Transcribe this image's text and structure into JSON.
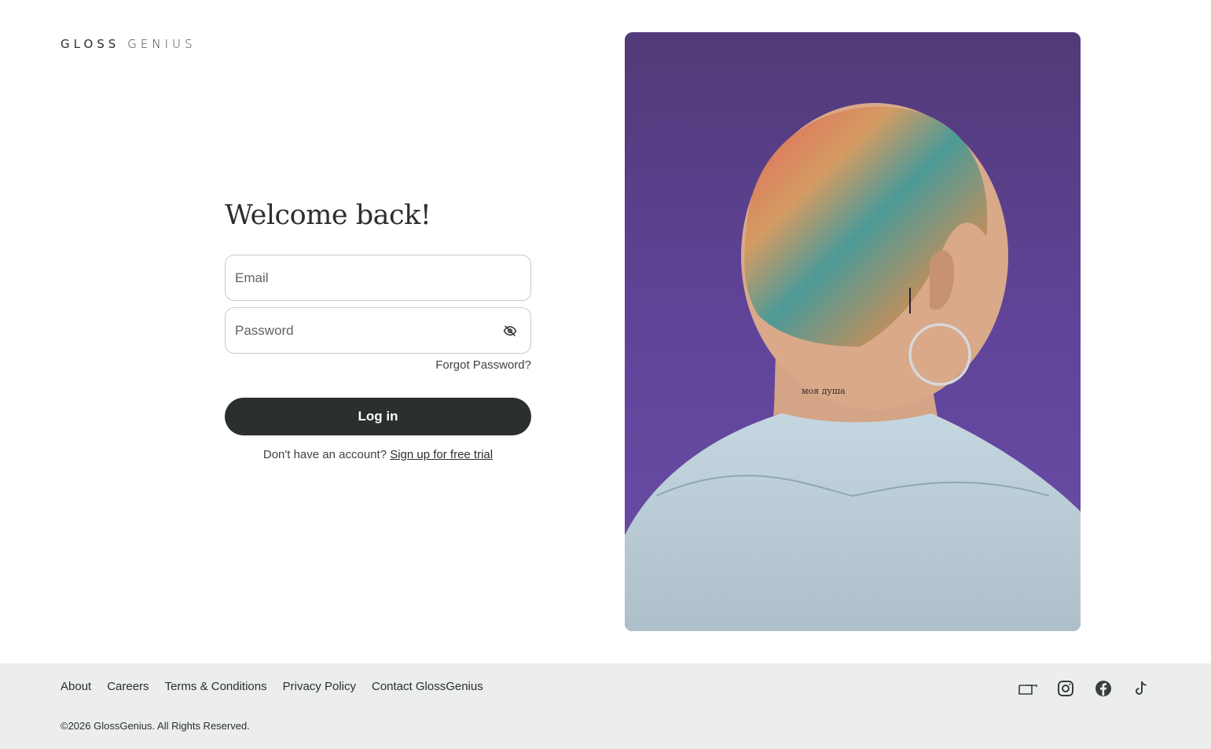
{
  "brand": {
    "word1": "GLOSS",
    "word2": "GENIUS"
  },
  "login": {
    "title": "Welcome back!",
    "email_placeholder": "Email",
    "password_placeholder": "Password",
    "forgot_label": "Forgot Password?",
    "login_label": "Log in",
    "signup_prompt": "Don't have an account?",
    "signup_link": "Sign up for free trial"
  },
  "hero": {
    "alt": "",
    "neck_tattoo": "моя душа"
  },
  "footer": {
    "links": [
      "About",
      "Careers",
      "Terms & Conditions",
      "Privacy Policy",
      "Contact GlossGenius"
    ],
    "copyright": "©2026 GlossGenius. All Rights Reserved.",
    "socials": [
      "media-icon",
      "instagram-icon",
      "facebook-icon",
      "tiktok-icon"
    ]
  },
  "colors": {
    "primary": "#2b2f2f",
    "footer_bg": "#eceeed",
    "photo_bg": "#5b3f86"
  }
}
